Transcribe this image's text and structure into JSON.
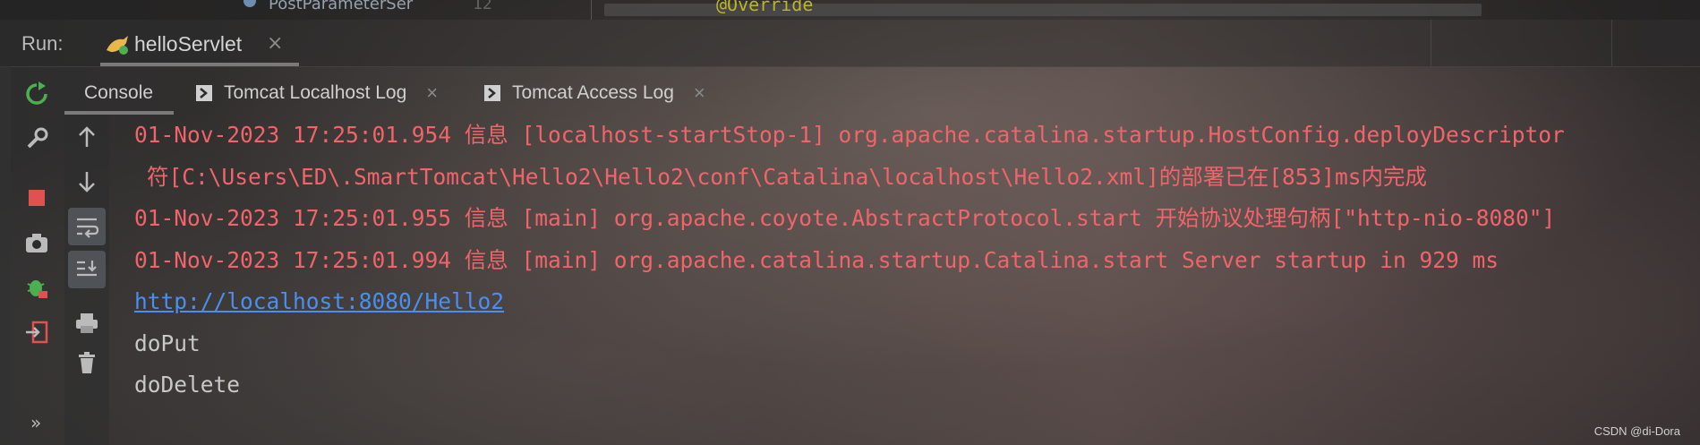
{
  "topstrip": {
    "file_fragment": "PostParameterSer",
    "line_number": "12",
    "annotation": "@Override"
  },
  "run_bar": {
    "label": "Run:",
    "tab": {
      "title": "helloServlet",
      "close": "×"
    }
  },
  "console_tabs": [
    {
      "label": "Console"
    },
    {
      "label": "Tomcat Localhost Log",
      "close": "×"
    },
    {
      "label": "Tomcat Access Log",
      "close": "×"
    }
  ],
  "console": {
    "lines": [
      "01-Nov-2023 17:25:01.954 信息 [localhost-startStop-1] org.apache.catalina.startup.HostConfig.deployDescriptor",
      "符[C:\\Users\\ED\\.SmartTomcat\\Hello2\\Hello2\\conf\\Catalina\\localhost\\Hello2.xml]的部署已在[853]ms内完成",
      "01-Nov-2023 17:25:01.955 信息 [main] org.apache.coyote.AbstractProtocol.start 开始协议处理句柄[\"http-nio-8080\"]",
      "01-Nov-2023 17:25:01.994 信息 [main] org.apache.catalina.startup.Catalina.start Server startup in 929 ms",
      "http://localhost:8080/Hello2",
      "doPut",
      "doDelete"
    ]
  },
  "left_toolbar": {
    "icons": [
      "rerun-icon",
      "wrench-icon",
      "stop-icon",
      "camera-icon",
      "debug-icon",
      "exit-icon"
    ],
    "more": "»"
  },
  "inner_toolbar": {
    "icons": [
      "arrow-up-icon",
      "arrow-down-icon",
      "soft-wrap-icon",
      "scroll-to-end-icon",
      "print-icon",
      "trash-icon"
    ]
  },
  "watermark": "CSDN @di-Dora",
  "colors": {
    "error_text": "#f0646a",
    "normal_text": "#c8c8c8",
    "link_text": "#4a8ff0",
    "rerun_green": "#4caf50",
    "stop_red": "#e05252"
  }
}
